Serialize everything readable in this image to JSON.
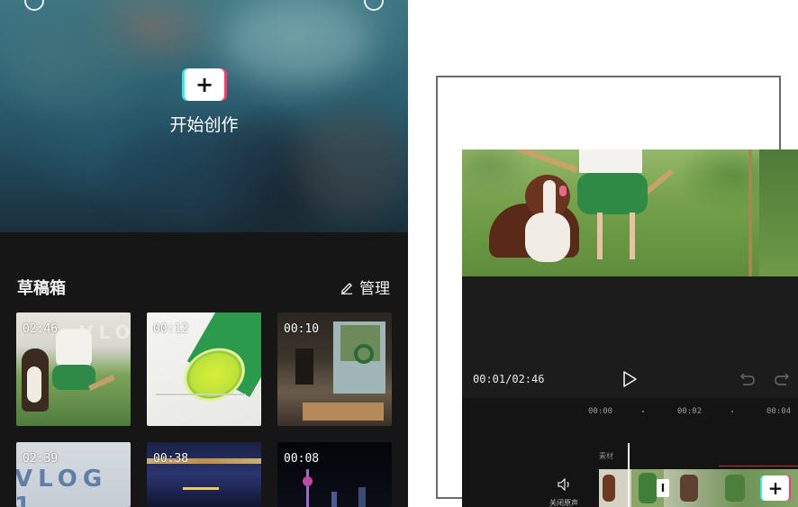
{
  "home": {
    "start_label": "开始创作",
    "start_icon": "plus-icon",
    "drafts_title": "草稿箱",
    "manage_label": "管理",
    "drafts": [
      {
        "duration": "02:46",
        "overlay": "VLO"
      },
      {
        "duration": "00:12"
      },
      {
        "duration": "00:10"
      },
      {
        "duration": "02:39",
        "overlay": "VLOG 1"
      },
      {
        "duration": "00:38"
      },
      {
        "duration": "00:08"
      }
    ]
  },
  "editor": {
    "time_readout": "00:01/02:46",
    "ruler": [
      "00:00",
      "00:02",
      "00:04"
    ],
    "track_label": "素材",
    "mute_label": "关闭原声",
    "divider_label": "I",
    "add_label": "+"
  },
  "colors": {
    "accent_cyan": "#3ee6e0",
    "accent_red": "#ff3a6b",
    "dark_bg": "#161616"
  }
}
